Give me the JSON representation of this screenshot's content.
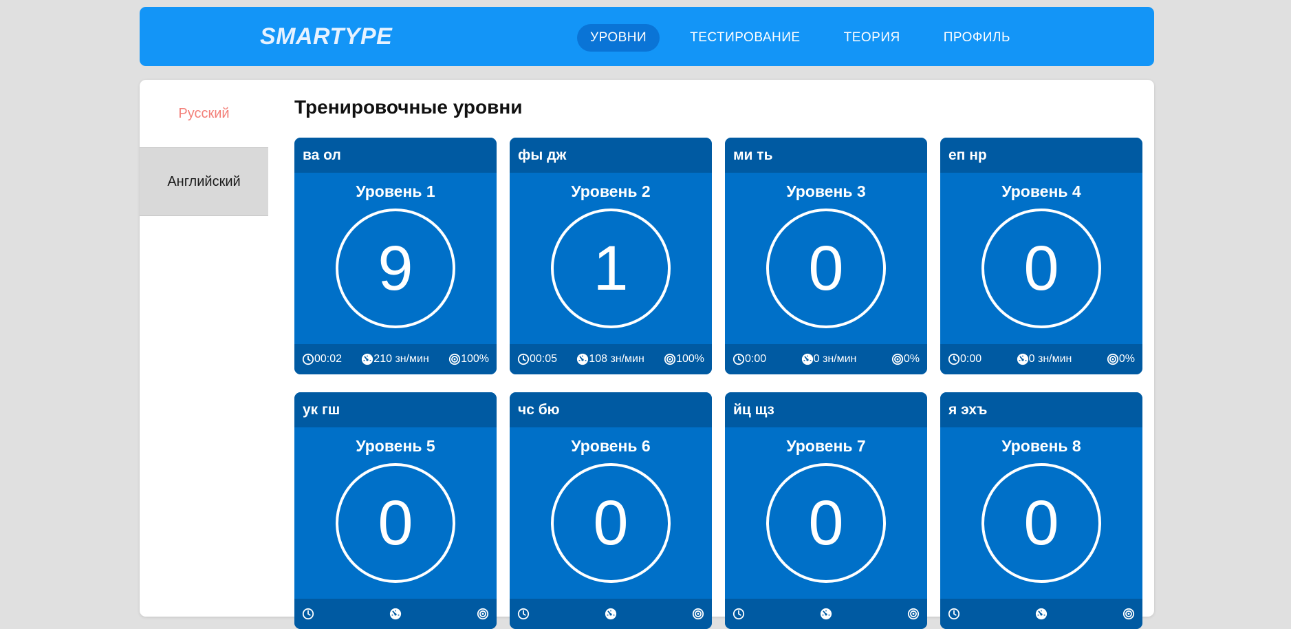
{
  "header": {
    "logo": "SMARTYPE",
    "nav": [
      {
        "label": "УРОВНИ",
        "active": true
      },
      {
        "label": "ТЕСТИРОВАНИЕ",
        "active": false
      },
      {
        "label": "ТЕОРИЯ",
        "active": false
      },
      {
        "label": "ПРОФИЛЬ",
        "active": false
      }
    ]
  },
  "sidebar": {
    "languages": [
      {
        "label": "Русский",
        "active": true
      },
      {
        "label": "Английский",
        "active": false
      }
    ]
  },
  "main": {
    "title": "Тренировочные уровни",
    "levels": [
      {
        "keys": "ва ол",
        "name": "Уровень 1",
        "score": "9",
        "time": "00:02",
        "speed": "210 зн/мин",
        "accuracy": "100%"
      },
      {
        "keys": "фы дж",
        "name": "Уровень 2",
        "score": "1",
        "time": "00:05",
        "speed": "108 зн/мин",
        "accuracy": "100%"
      },
      {
        "keys": "ми ть",
        "name": "Уровень 3",
        "score": "0",
        "time": "0:00",
        "speed": "0 зн/мин",
        "accuracy": "0%"
      },
      {
        "keys": "еп нр",
        "name": "Уровень 4",
        "score": "0",
        "time": "0:00",
        "speed": "0 зн/мин",
        "accuracy": "0%"
      },
      {
        "keys": "ук гш",
        "name": "Уровень 5",
        "score": "0",
        "time": "",
        "speed": "",
        "accuracy": ""
      },
      {
        "keys": "чс бю",
        "name": "Уровень 6",
        "score": "0",
        "time": "",
        "speed": "",
        "accuracy": ""
      },
      {
        "keys": "йц щз",
        "name": "Уровень 7",
        "score": "0",
        "time": "",
        "speed": "",
        "accuracy": ""
      },
      {
        "keys": "я эхъ",
        "name": "Уровень 8",
        "score": "0",
        "time": "",
        "speed": "",
        "accuracy": ""
      }
    ]
  },
  "icons": {
    "time": "clock-icon",
    "speed": "speedometer-icon",
    "accuracy": "target-icon"
  },
  "colors": {
    "header_bg": "#1395f7",
    "nav_active_bg": "#0a74d6",
    "card_bg": "#0070c8",
    "card_dark": "#005aa2",
    "active_language": "#f37f78"
  }
}
